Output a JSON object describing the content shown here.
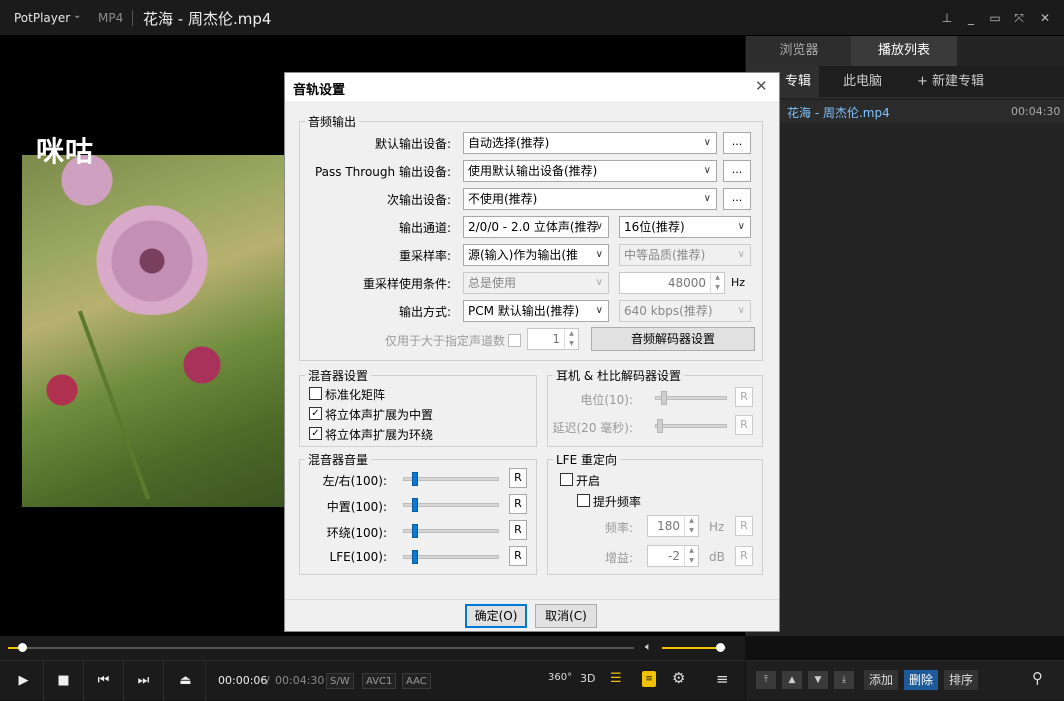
{
  "titlebar": {
    "brand": "PotPlayer",
    "format": "MP4",
    "title": "花海 - 周杰伦.mp4"
  },
  "video": {
    "logo_text": "咪咕"
  },
  "right_panel": {
    "tabs": [
      "浏览器",
      "播放列表"
    ],
    "subtabs": [
      "专辑",
      "此电脑",
      "+ 新建专辑"
    ],
    "playlist": [
      {
        "title": "花海 - 周杰伦.mp4",
        "duration": "00:04:30"
      }
    ],
    "bottom_buttons": {
      "add": "添加",
      "delete": "删除",
      "sort": "排序"
    }
  },
  "player": {
    "current_time": "00:00:06",
    "separator": "/",
    "total_time": "00:04:30",
    "tags": [
      "S/W",
      "AVC1",
      "AAC"
    ],
    "icon_labels": {
      "vr": "360°",
      "three_d": "3D"
    },
    "progress": 0.022,
    "volume": 0.9
  },
  "dialog": {
    "title": "音轨设置",
    "audio_output": {
      "group_title": "音频输出",
      "rows": {
        "default_device_label": "默认输出设备:",
        "default_device_value": "自动选择(推荐)",
        "passthrough_label": "Pass Through 输出设备:",
        "passthrough_value": "使用默认输出设备(推荐)",
        "secondary_label": "次输出设备:",
        "secondary_value": "不使用(推荐)",
        "channel_label": "输出通道:",
        "channel_value": "2/0/0 - 2.0 立体声(推荐",
        "bits_value": "16位(推荐)",
        "resample_label": "重采样率:",
        "resample_value": "源(输入)作为输出(推",
        "quality_value": "中等品质(推荐)",
        "resample_cond_label": "重采样使用条件:",
        "resample_cond_value": "总是使用",
        "hz_value": "48000",
        "hz_unit": "Hz",
        "output_mode_label": "输出方式:",
        "output_mode_value": "PCM 默认输出(推荐)",
        "bitrate_value": "640 kbps(推荐)",
        "channel_count_label": "仅用于大于指定声道数",
        "channel_count_value": "1",
        "decoder_button": "音频解码器设置",
        "more_button": "..."
      }
    },
    "mixer_settings": {
      "group_title": "混音器设置",
      "options": [
        {
          "label": "标准化矩阵",
          "checked": false
        },
        {
          "label": "将立体声扩展为中置",
          "checked": true
        },
        {
          "label": "将立体声扩展为环绕",
          "checked": true
        }
      ]
    },
    "headphone": {
      "group_title": "耳机 & 杜比解码器设置",
      "level_label": "电位(10):",
      "delay_label": "延迟(20 毫秒):",
      "reset": "R"
    },
    "mixer_volume": {
      "group_title": "混音器音量",
      "rows": [
        {
          "label": "左/右(100):",
          "level": 0.12
        },
        {
          "label": "中置(100):",
          "level": 0.12
        },
        {
          "label": "环绕(100):",
          "level": 0.12
        },
        {
          "label": "LFE(100):",
          "level": 0.12
        }
      ],
      "reset": "R"
    },
    "lfe": {
      "group_title": "LFE 重定向",
      "enable_label": "开启",
      "boost_label": "提升频率",
      "freq_label": "频率:",
      "freq_value": "180",
      "freq_unit": "Hz",
      "gain_label": "增益:",
      "gain_value": "-2",
      "gain_unit": "dB",
      "reset": "R"
    },
    "ok_button": "确定(O)",
    "cancel_button": "取消(C)"
  }
}
